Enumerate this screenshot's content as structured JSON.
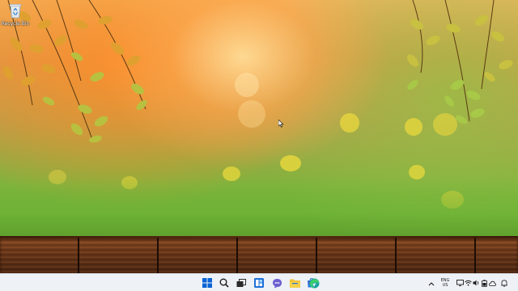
{
  "desktop": {
    "icons": [
      {
        "label": "Recycle Bin"
      }
    ]
  },
  "taskbar": {
    "apps": [
      {
        "icon": "windows-start-icon"
      },
      {
        "icon": "search-icon"
      },
      {
        "icon": "task-view-icon"
      },
      {
        "icon": "widgets-icon"
      },
      {
        "icon": "teams-chat-icon"
      },
      {
        "icon": "file-explorer-icon"
      },
      {
        "icon": "microsoft-store-icon"
      },
      {
        "icon": "edge-browser-icon"
      }
    ],
    "tray": {
      "language": "ENG",
      "region": "US",
      "icons": [
        "chevron-up-icon",
        "display-icon",
        "wifi-icon",
        "volume-icon",
        "battery-icon",
        "cloud-icon",
        "notification-icon"
      ]
    }
  },
  "colors": {
    "taskbar_bg": "#eef1f6",
    "start_blue": "#0a64d6",
    "explorer_yellow": "#f2c12e",
    "edge_teal": "#1aa3a0"
  }
}
